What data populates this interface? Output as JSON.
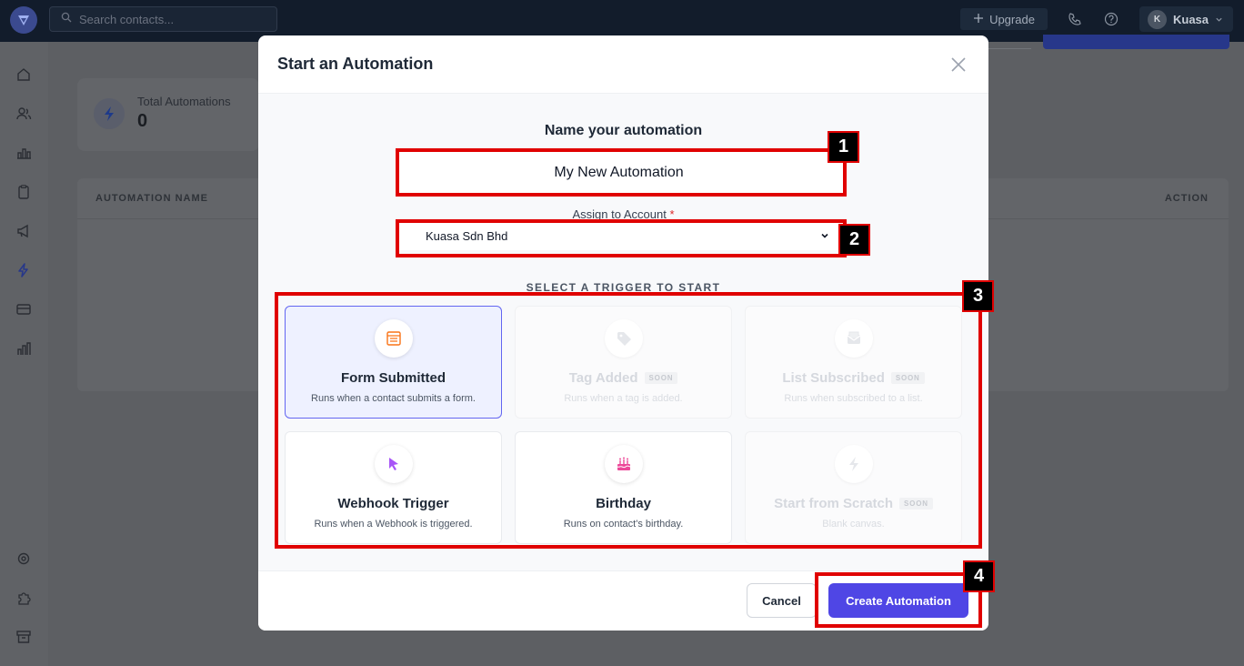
{
  "topbar": {
    "search_placeholder": "Search contacts...",
    "upgrade_label": "Upgrade",
    "user_initial": "K",
    "user_name": "Kuasa"
  },
  "background": {
    "stat_label": "Total Automations",
    "stat_value": "0",
    "table_col_name": "AUTOMATION NAME",
    "table_col_action": "ACTION"
  },
  "modal": {
    "title": "Start an Automation",
    "name_heading": "Name your automation",
    "name_value": "My New Automation",
    "assign_label": "Assign to Account",
    "required_mark": "*",
    "account_selected": "Kuasa Sdn Bhd",
    "trigger_heading": "SELECT A TRIGGER TO START",
    "triggers": [
      {
        "title": "Form Submitted",
        "desc": "Runs when a contact submits a form.",
        "icon": "form-icon",
        "state": "selected"
      },
      {
        "title": "Tag Added",
        "desc": "Runs when a tag is added.",
        "icon": "tag-icon",
        "state": "disabled",
        "badge": "SOON"
      },
      {
        "title": "List Subscribed",
        "desc": "Runs when subscribed to a list.",
        "icon": "mail-icon",
        "state": "disabled",
        "badge": "SOON"
      },
      {
        "title": "Webhook Trigger",
        "desc": "Runs when a Webhook is triggered.",
        "icon": "cursor-icon",
        "state": "available"
      },
      {
        "title": "Birthday",
        "desc": "Runs on contact's birthday.",
        "icon": "cake-icon",
        "state": "available"
      },
      {
        "title": "Start from Scratch",
        "desc": "Blank canvas.",
        "icon": "bolt-icon",
        "state": "disabled",
        "badge": "SOON"
      }
    ],
    "cancel_label": "Cancel",
    "create_label": "Create Automation"
  },
  "annotations": [
    "1",
    "2",
    "3",
    "4"
  ],
  "colors": {
    "primary": "#4f46e5",
    "annotation_red": "#e00000",
    "form_icon": "#f97316",
    "webhook_icon": "#a855f7",
    "birthday_icon": "#ec4899"
  }
}
